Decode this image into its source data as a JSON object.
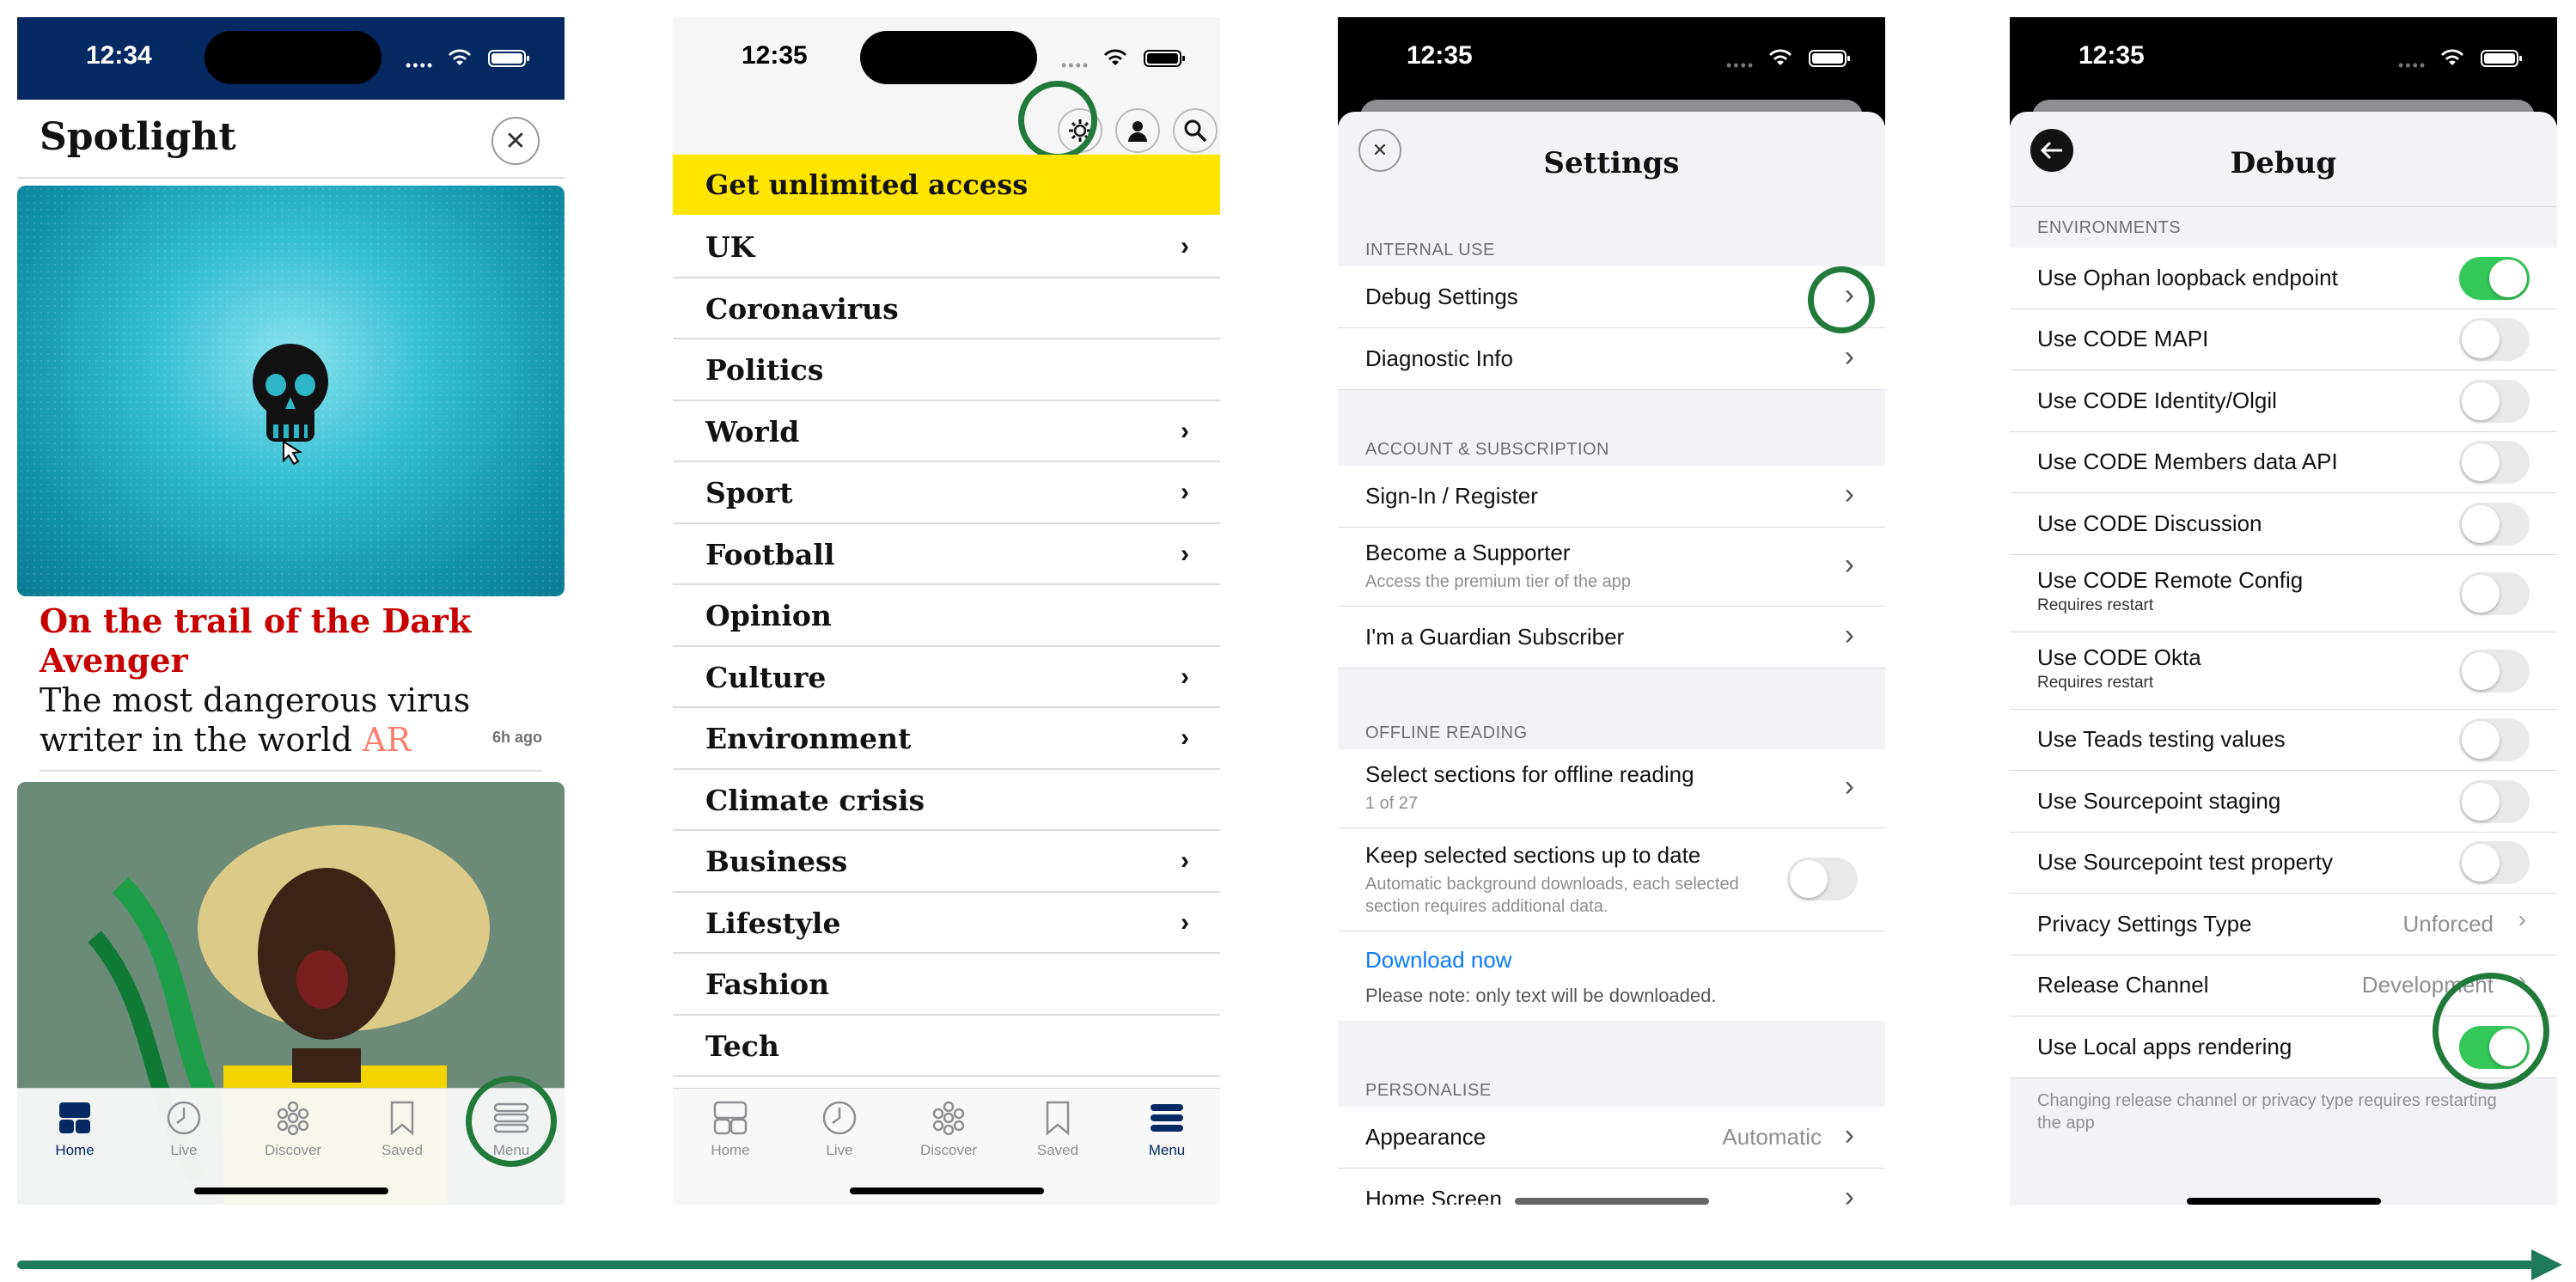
{
  "panel1": {
    "time": "12:34",
    "title": "Spotlight",
    "close_glyph": "✕",
    "headline_kicker": "On the trail of the Dark Avenger",
    "headline_text": "The most dangerous virus writer in the world",
    "headline_tag": "AR",
    "timestamp": "6h ago",
    "tabs": [
      "Home",
      "Live",
      "Discover",
      "Saved",
      "Menu"
    ],
    "active_tab": "Home"
  },
  "panel2": {
    "time": "12:35",
    "banner": "Get unlimited access",
    "items": [
      {
        "label": "UK",
        "chevron": true
      },
      {
        "label": "Coronavirus",
        "chevron": false
      },
      {
        "label": "Politics",
        "chevron": false
      },
      {
        "label": "World",
        "chevron": true
      },
      {
        "label": "Sport",
        "chevron": true
      },
      {
        "label": "Football",
        "chevron": true
      },
      {
        "label": "Opinion",
        "chevron": false
      },
      {
        "label": "Culture",
        "chevron": true
      },
      {
        "label": "Environment",
        "chevron": true
      },
      {
        "label": "Climate crisis",
        "chevron": false
      },
      {
        "label": "Business",
        "chevron": true
      },
      {
        "label": "Lifestyle",
        "chevron": true
      },
      {
        "label": "Fashion",
        "chevron": false
      },
      {
        "label": "Tech",
        "chevron": false
      }
    ],
    "tabs": [
      "Home",
      "Live",
      "Discover",
      "Saved",
      "Menu"
    ],
    "active_tab": "Menu"
  },
  "panel3": {
    "time": "12:35",
    "title": "Settings",
    "sections": {
      "internal": "INTERNAL USE",
      "account": "ACCOUNT & SUBSCRIPTION",
      "offline": "OFFLINE READING",
      "personalise": "PERSONALISE"
    },
    "debug_settings": "Debug Settings",
    "diagnostic_info": "Diagnostic Info",
    "sign_in": "Sign-In / Register",
    "become_supporter": "Become a Supporter",
    "become_supporter_sub": "Access the premium tier of the app",
    "subscriber": "I'm a Guardian Subscriber",
    "select_sections": "Select sections for offline reading",
    "select_sections_sub": "1 of 27",
    "keep_updated": "Keep selected sections up to date",
    "keep_updated_sub": "Automatic background downloads, each selected section requires additional data.",
    "download_now": "Download now",
    "download_note": "Please note: only text will be downloaded.",
    "appearance": "Appearance",
    "appearance_value": "Automatic",
    "home_screen": "Home Screen"
  },
  "panel4": {
    "time": "12:35",
    "title": "Debug",
    "section": "ENVIRONMENTS",
    "rows": [
      {
        "label": "Use Ophan loopback endpoint",
        "sub": "",
        "on": true
      },
      {
        "label": "Use CODE MAPI",
        "sub": "",
        "on": false
      },
      {
        "label": "Use CODE Identity/Olgil",
        "sub": "",
        "on": false
      },
      {
        "label": "Use CODE Members data API",
        "sub": "",
        "on": false
      },
      {
        "label": "Use CODE Discussion",
        "sub": "",
        "on": false
      },
      {
        "label": "Use CODE Remote Config",
        "sub": "Requires restart",
        "on": false
      },
      {
        "label": "Use CODE Okta",
        "sub": "Requires restart",
        "on": false
      },
      {
        "label": "Use Teads testing values",
        "sub": "",
        "on": false
      },
      {
        "label": "Use Sourcepoint staging",
        "sub": "",
        "on": false
      },
      {
        "label": "Use Sourcepoint test property",
        "sub": "",
        "on": false
      }
    ],
    "privacy_type": "Privacy Settings Type",
    "privacy_value": "Unforced",
    "release_channel": "Release Channel",
    "release_value": "Development",
    "local_rendering": "Use Local apps rendering",
    "local_rendering_on": true,
    "footer": "Changing release channel or privacy type requires restarting the app"
  },
  "colors": {
    "guardian_blue": "#052962",
    "guardian_red": "#c70000",
    "yellow": "#ffe500",
    "ios_green": "#34c759",
    "highlight_ring": "#217a3a",
    "link_blue": "#0a7aff"
  }
}
